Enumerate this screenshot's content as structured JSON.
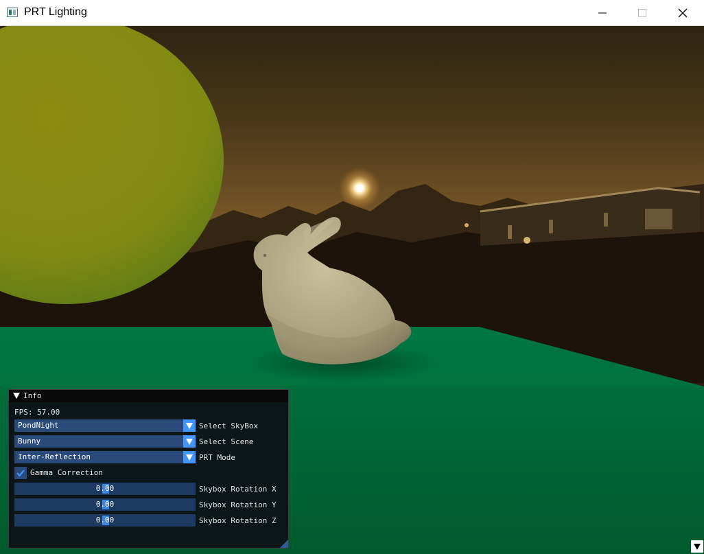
{
  "window": {
    "title": "PRT Lighting",
    "controls": [
      "minimize-icon",
      "maximize-icon",
      "close-icon"
    ]
  },
  "panel": {
    "title": "Info",
    "fps_label": "FPS:",
    "fps_value": "57.00",
    "skybox": {
      "value": "PondNight",
      "label": "Select SkyBox"
    },
    "scene": {
      "value": "Bunny",
      "label": "Select Scene"
    },
    "prt_mode": {
      "value": "Inter-Reflection",
      "label": "PRT Mode"
    },
    "gamma": {
      "label": "Gamma Correction",
      "checked": true
    },
    "rotation_x": {
      "value": "0.00",
      "label": "Skybox Rotation X"
    },
    "rotation_y": {
      "value": "0.00",
      "label": "Skybox Rotation Y"
    },
    "rotation_z": {
      "value": "0.00",
      "label": "Skybox Rotation Z"
    }
  },
  "colors": {
    "sky_top": "#3f2e16",
    "sky_horizon": "#7a5a2c",
    "ground_plane": "#006b3c",
    "sphere": "#8a8a10",
    "bunny": "#b8ae8c",
    "imgui_frame": "#294a7a",
    "imgui_accent": "#4296fa"
  }
}
